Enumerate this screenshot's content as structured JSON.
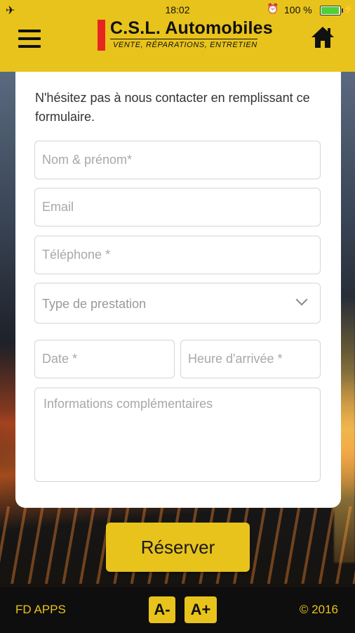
{
  "status_bar": {
    "time": "18:02",
    "battery_percent": "100 %",
    "battery_level": 1.0,
    "icons": [
      "airplane-icon",
      "alarm-icon",
      "battery-icon",
      "charging-icon"
    ]
  },
  "header": {
    "brand_name": "C.S.L. Automobiles",
    "tagline": "VENTE, RÉPARATIONS, ENTRETIEN",
    "menu_icon": "hamburger-menu-icon",
    "home_icon": "home-icon",
    "colors": {
      "bar": "#e8c31c",
      "logo_accent": "#e5261f"
    }
  },
  "form": {
    "intro": "N'hésitez pas à nous contacter en remplissant ce formulaire.",
    "name_placeholder": "Nom & prénom*",
    "email_placeholder": "Email",
    "phone_placeholder": "Téléphone *",
    "service_type": "Type de prestation",
    "date_placeholder": "Date *",
    "arrival_placeholder": "Heure d'arrivée *",
    "info_placeholder": "Informations complémentaires"
  },
  "actions": {
    "reserve_label": "Réserver"
  },
  "footer": {
    "credit": "FD APPS",
    "font_smaller": "A-",
    "font_larger": "A+",
    "copyright": "© 2016"
  }
}
